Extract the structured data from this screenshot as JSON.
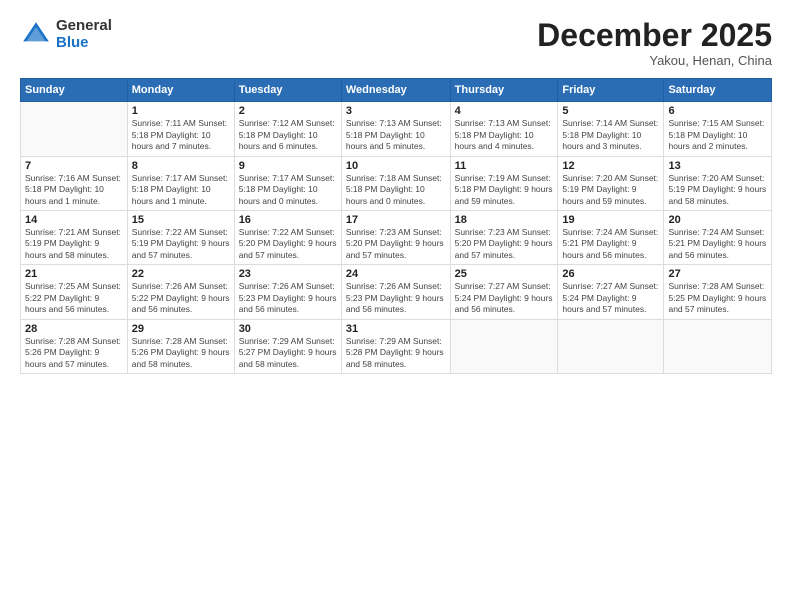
{
  "logo": {
    "general": "General",
    "blue": "Blue"
  },
  "header": {
    "month": "December 2025",
    "location": "Yakou, Henan, China"
  },
  "weekdays": [
    "Sunday",
    "Monday",
    "Tuesday",
    "Wednesday",
    "Thursday",
    "Friday",
    "Saturday"
  ],
  "weeks": [
    [
      {
        "day": "",
        "info": ""
      },
      {
        "day": "1",
        "info": "Sunrise: 7:11 AM\nSunset: 5:18 PM\nDaylight: 10 hours\nand 7 minutes."
      },
      {
        "day": "2",
        "info": "Sunrise: 7:12 AM\nSunset: 5:18 PM\nDaylight: 10 hours\nand 6 minutes."
      },
      {
        "day": "3",
        "info": "Sunrise: 7:13 AM\nSunset: 5:18 PM\nDaylight: 10 hours\nand 5 minutes."
      },
      {
        "day": "4",
        "info": "Sunrise: 7:13 AM\nSunset: 5:18 PM\nDaylight: 10 hours\nand 4 minutes."
      },
      {
        "day": "5",
        "info": "Sunrise: 7:14 AM\nSunset: 5:18 PM\nDaylight: 10 hours\nand 3 minutes."
      },
      {
        "day": "6",
        "info": "Sunrise: 7:15 AM\nSunset: 5:18 PM\nDaylight: 10 hours\nand 2 minutes."
      }
    ],
    [
      {
        "day": "7",
        "info": "Sunrise: 7:16 AM\nSunset: 5:18 PM\nDaylight: 10 hours\nand 1 minute."
      },
      {
        "day": "8",
        "info": "Sunrise: 7:17 AM\nSunset: 5:18 PM\nDaylight: 10 hours\nand 1 minute."
      },
      {
        "day": "9",
        "info": "Sunrise: 7:17 AM\nSunset: 5:18 PM\nDaylight: 10 hours\nand 0 minutes."
      },
      {
        "day": "10",
        "info": "Sunrise: 7:18 AM\nSunset: 5:18 PM\nDaylight: 10 hours\nand 0 minutes."
      },
      {
        "day": "11",
        "info": "Sunrise: 7:19 AM\nSunset: 5:18 PM\nDaylight: 9 hours\nand 59 minutes."
      },
      {
        "day": "12",
        "info": "Sunrise: 7:20 AM\nSunset: 5:19 PM\nDaylight: 9 hours\nand 59 minutes."
      },
      {
        "day": "13",
        "info": "Sunrise: 7:20 AM\nSunset: 5:19 PM\nDaylight: 9 hours\nand 58 minutes."
      }
    ],
    [
      {
        "day": "14",
        "info": "Sunrise: 7:21 AM\nSunset: 5:19 PM\nDaylight: 9 hours\nand 58 minutes."
      },
      {
        "day": "15",
        "info": "Sunrise: 7:22 AM\nSunset: 5:19 PM\nDaylight: 9 hours\nand 57 minutes."
      },
      {
        "day": "16",
        "info": "Sunrise: 7:22 AM\nSunset: 5:20 PM\nDaylight: 9 hours\nand 57 minutes."
      },
      {
        "day": "17",
        "info": "Sunrise: 7:23 AM\nSunset: 5:20 PM\nDaylight: 9 hours\nand 57 minutes."
      },
      {
        "day": "18",
        "info": "Sunrise: 7:23 AM\nSunset: 5:20 PM\nDaylight: 9 hours\nand 57 minutes."
      },
      {
        "day": "19",
        "info": "Sunrise: 7:24 AM\nSunset: 5:21 PM\nDaylight: 9 hours\nand 56 minutes."
      },
      {
        "day": "20",
        "info": "Sunrise: 7:24 AM\nSunset: 5:21 PM\nDaylight: 9 hours\nand 56 minutes."
      }
    ],
    [
      {
        "day": "21",
        "info": "Sunrise: 7:25 AM\nSunset: 5:22 PM\nDaylight: 9 hours\nand 56 minutes."
      },
      {
        "day": "22",
        "info": "Sunrise: 7:26 AM\nSunset: 5:22 PM\nDaylight: 9 hours\nand 56 minutes."
      },
      {
        "day": "23",
        "info": "Sunrise: 7:26 AM\nSunset: 5:23 PM\nDaylight: 9 hours\nand 56 minutes."
      },
      {
        "day": "24",
        "info": "Sunrise: 7:26 AM\nSunset: 5:23 PM\nDaylight: 9 hours\nand 56 minutes."
      },
      {
        "day": "25",
        "info": "Sunrise: 7:27 AM\nSunset: 5:24 PM\nDaylight: 9 hours\nand 56 minutes."
      },
      {
        "day": "26",
        "info": "Sunrise: 7:27 AM\nSunset: 5:24 PM\nDaylight: 9 hours\nand 57 minutes."
      },
      {
        "day": "27",
        "info": "Sunrise: 7:28 AM\nSunset: 5:25 PM\nDaylight: 9 hours\nand 57 minutes."
      }
    ],
    [
      {
        "day": "28",
        "info": "Sunrise: 7:28 AM\nSunset: 5:26 PM\nDaylight: 9 hours\nand 57 minutes."
      },
      {
        "day": "29",
        "info": "Sunrise: 7:28 AM\nSunset: 5:26 PM\nDaylight: 9 hours\nand 58 minutes."
      },
      {
        "day": "30",
        "info": "Sunrise: 7:29 AM\nSunset: 5:27 PM\nDaylight: 9 hours\nand 58 minutes."
      },
      {
        "day": "31",
        "info": "Sunrise: 7:29 AM\nSunset: 5:28 PM\nDaylight: 9 hours\nand 58 minutes."
      },
      {
        "day": "",
        "info": ""
      },
      {
        "day": "",
        "info": ""
      },
      {
        "day": "",
        "info": ""
      }
    ]
  ]
}
